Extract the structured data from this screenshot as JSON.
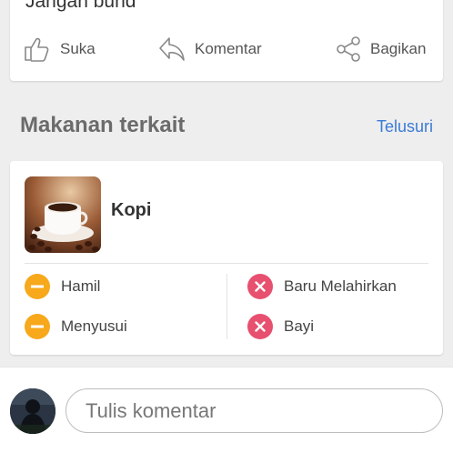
{
  "post": {
    "text": "Jangan bund",
    "actions": {
      "like_label": "Suka",
      "comment_label": "Komentar",
      "share_label": "Bagikan"
    }
  },
  "related": {
    "title": "Makanan terkait",
    "browse_label": "Telusuri",
    "food": {
      "name": "Kopi",
      "statuses": [
        {
          "label": "Hamil",
          "level": "caution"
        },
        {
          "label": "Baru Melahirkan",
          "level": "not-safe"
        },
        {
          "label": "Menyusui",
          "level": "caution"
        },
        {
          "label": "Bayi",
          "level": "not-safe"
        }
      ]
    }
  },
  "comment": {
    "placeholder": "Tulis komentar"
  },
  "colors": {
    "caution": "#f7a81b",
    "not_safe": "#e8506f",
    "link": "#3b7bd6"
  }
}
